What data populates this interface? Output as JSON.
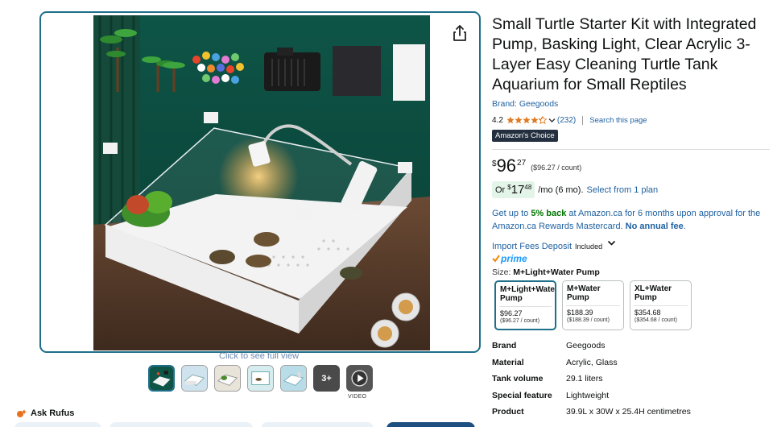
{
  "gallery": {
    "click_full_view": "Click to see full view",
    "more_count": "3+",
    "video_label": "VIDEO",
    "thumbnail_count": 8
  },
  "ask_rufus": {
    "label": "Ask Rufus"
  },
  "product": {
    "title": "Small Turtle Starter Kit with Integrated Pump, Basking Light, Clear Acrylic 3-Layer Easy Cleaning Turtle Tank Aquarium for Small Reptiles",
    "brand_link": "Brand: Geegoods",
    "rating": "4.2",
    "stars_filled": 4.2,
    "review_count": "(232)",
    "search_page": "Search this page",
    "badge": "Amazon's Choice"
  },
  "price": {
    "symbol": "$",
    "whole": "96",
    "fraction": "27",
    "per_unit": "($96.27 / count)"
  },
  "monthly": {
    "or": "Or",
    "symbol": "$",
    "whole": "17",
    "fraction": "48",
    "term": "/mo (6 mo).",
    "select": "Select from 1 plan"
  },
  "rewards": {
    "prefix": "Get up to ",
    "highlight": "5% back",
    "middle": " at Amazon.ca for 6 months upon approval for the Amazon.ca Rewards Mastercard. ",
    "bold_end": "No annual fee",
    "suffix": "."
  },
  "import_fees": {
    "label": "Import Fees Deposit",
    "included": "Included"
  },
  "prime": {
    "label": "prime"
  },
  "size": {
    "label": "Size:",
    "selected": "M+Light+Water Pump"
  },
  "variants": [
    {
      "name": "M+Light+Water Pump",
      "price": "$96.27",
      "unit": "($96.27 / count)"
    },
    {
      "name": "M+Water Pump",
      "price": "$188.39",
      "unit": "($188.39 / count)"
    },
    {
      "name": "XL+Water Pump",
      "price": "$354.68",
      "unit": "($354.68 / count)"
    }
  ],
  "specs": [
    {
      "key": "Brand",
      "value": "Geegoods"
    },
    {
      "key": "Material",
      "value": "Acrylic, Glass"
    },
    {
      "key": "Tank volume",
      "value": "29.1 liters"
    },
    {
      "key": "Special feature",
      "value": "Lightweight"
    },
    {
      "key": "Product",
      "value": "39.9L x 30W x 25.4H centimetres"
    }
  ],
  "colors": {
    "accent_border": "#1f6f8a",
    "link": "#2162a1",
    "rewards_green": "#007600",
    "badge_bg": "#232f3e",
    "star": "#de7921",
    "prime_blue": "#1a98ff"
  }
}
